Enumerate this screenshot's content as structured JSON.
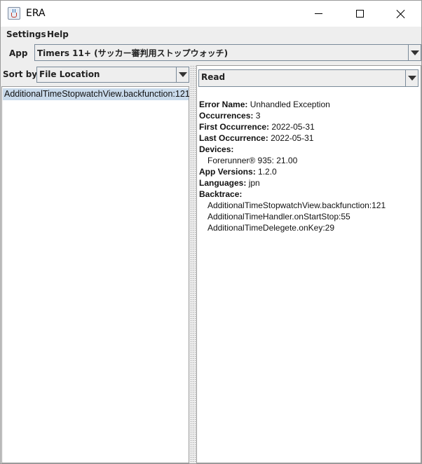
{
  "window": {
    "title": "ERA"
  },
  "menu": {
    "settings": "Settings",
    "help": "Help"
  },
  "app_selector": {
    "label": "App",
    "value": "Timers 11+ (サッカー審判用ストップウォッチ)"
  },
  "sort": {
    "label": "Sort by",
    "value": "File Location"
  },
  "list": {
    "items": [
      "AdditionalTimeStopwatchView.backfunction:121"
    ]
  },
  "status_filter": {
    "value": "Read"
  },
  "details": {
    "error_name_label": "Error Name:",
    "error_name": "Unhandled Exception",
    "occurrences_label": "Occurrences:",
    "occurrences": "3",
    "first_label": "First Occurrence:",
    "first": "2022-05-31",
    "last_label": "Last Occurrence:",
    "last": "2022-05-31",
    "devices_label": "Devices:",
    "devices": [
      "Forerunner® 935: 21.00"
    ],
    "versions_label": "App Versions:",
    "versions": "1.2.0",
    "languages_label": "Languages:",
    "languages": "jpn",
    "backtrace_label": "Backtrace:",
    "backtrace": [
      "AdditionalTimeStopwatchView.backfunction:121",
      "AdditionalTimeHandler.onStartStop:55",
      "AdditionalTimeDelegete.onKey:29"
    ]
  }
}
